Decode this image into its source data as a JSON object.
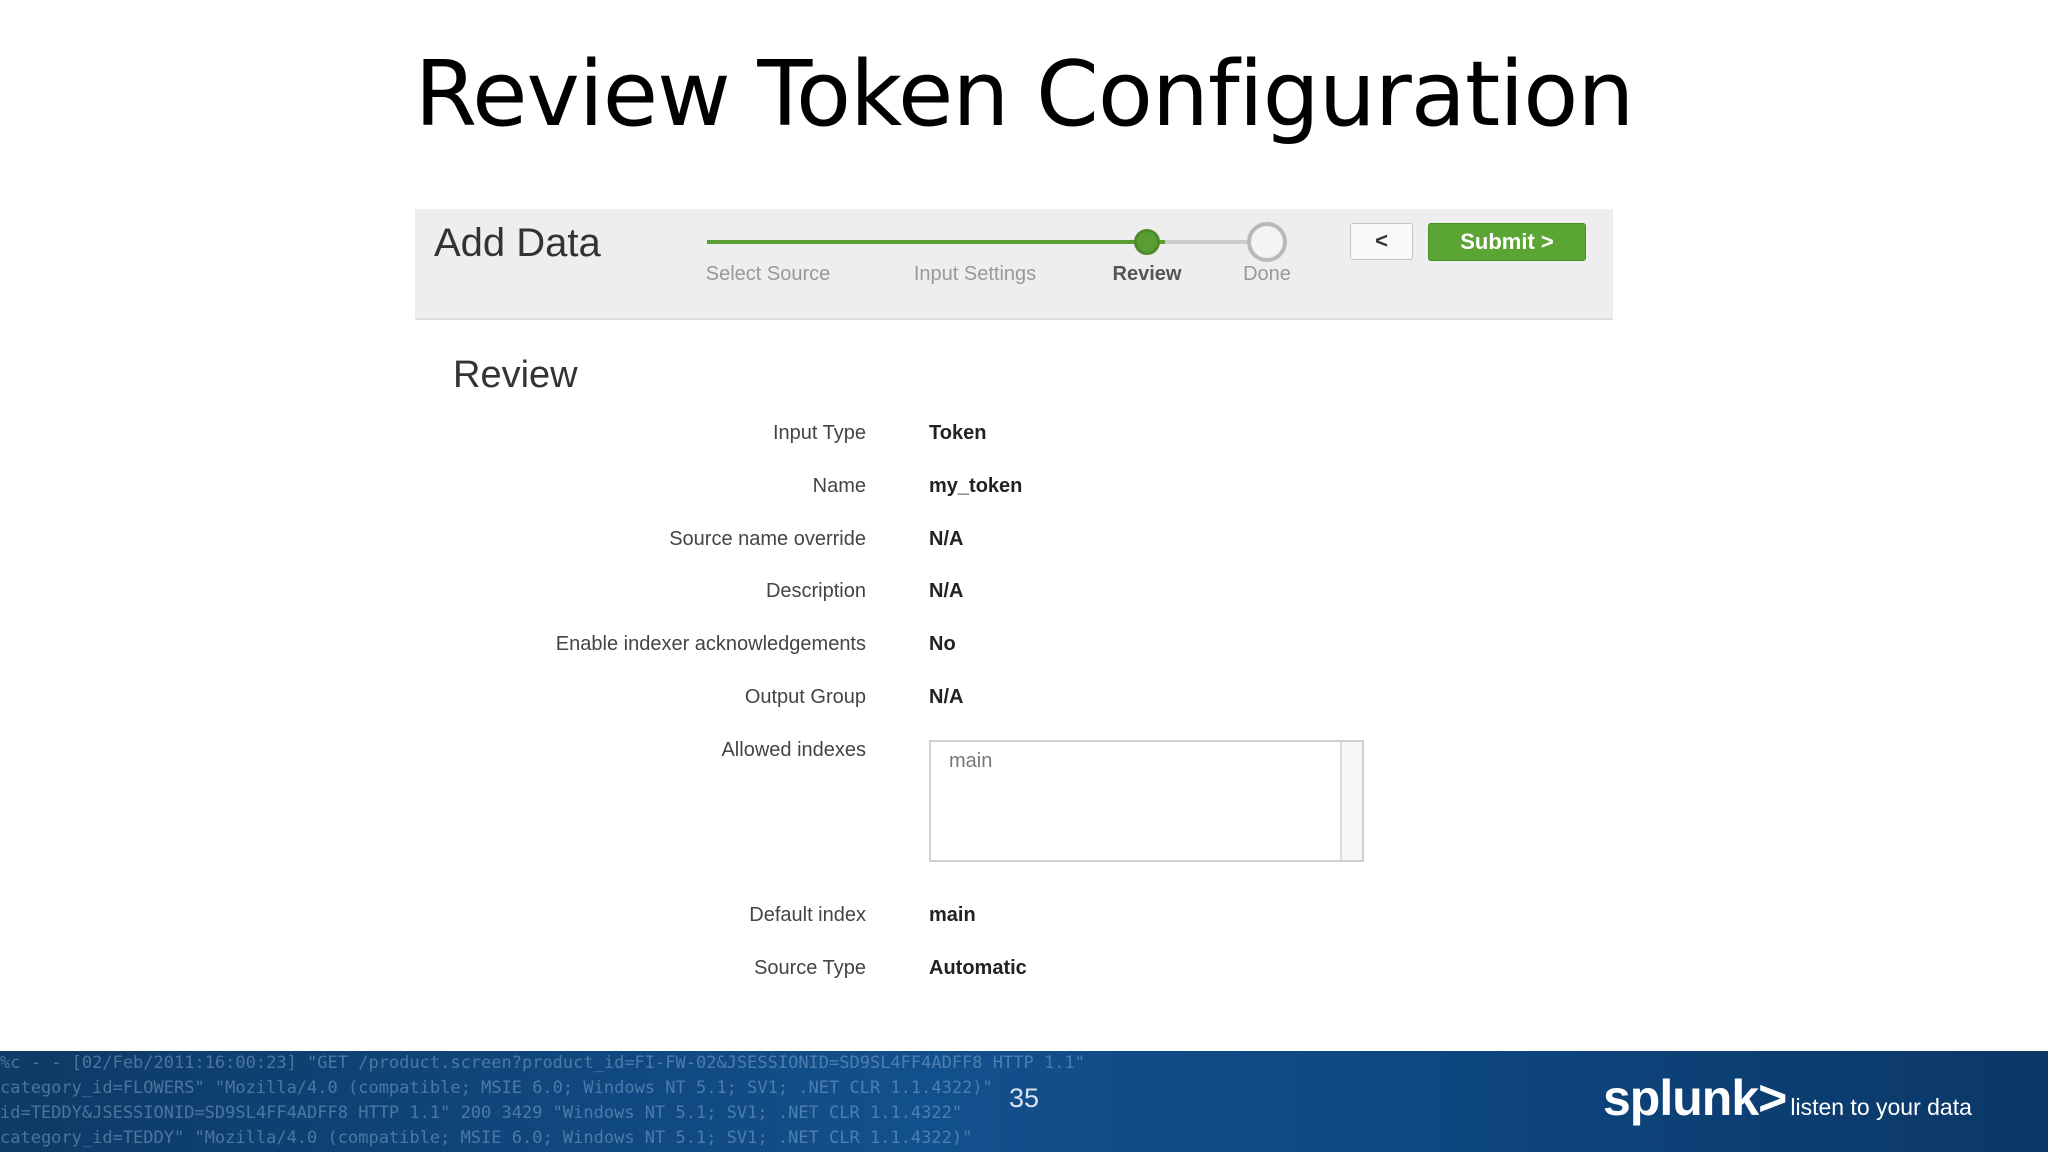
{
  "slide": {
    "title": "Review Token Configuration",
    "page_number": "35"
  },
  "header": {
    "title": "Add Data",
    "steps": [
      {
        "label": "Select Source",
        "state": "done"
      },
      {
        "label": "Input Settings",
        "state": "done"
      },
      {
        "label": "Review",
        "state": "current"
      },
      {
        "label": "Done",
        "state": "todo"
      }
    ],
    "back_label": "<",
    "submit_label": "Submit >"
  },
  "review": {
    "heading": "Review",
    "fields": [
      {
        "label": "Input Type",
        "value": "Token"
      },
      {
        "label": "Name",
        "value": "my_token"
      },
      {
        "label": "Source name override",
        "value": "N/A"
      },
      {
        "label": "Description",
        "value": "N/A"
      },
      {
        "label": "Enable indexer acknowledgements",
        "value": "No"
      },
      {
        "label": "Output Group",
        "value": "N/A"
      }
    ],
    "allowed_indexes": {
      "label": "Allowed indexes",
      "items": [
        "main"
      ]
    },
    "default_index": {
      "label": "Default index",
      "value": "main"
    },
    "source_type": {
      "label": "Source Type",
      "value": "Automatic"
    }
  },
  "footer": {
    "log_lines": [
      "%c - - [02/Feb/2011:16:00:23] \"GET /product.screen?product_id=FI-FW-02&JSESSIONID=SD9SL4FF4ADFF8 HTTP 1.1\"",
      "category_id=FLOWERS\" \"Mozilla/4.0 (compatible; MSIE 6.0; Windows NT 5.1; SV1; .NET CLR 1.1.4322)\"",
      "id=TEDDY&JSESSIONID=SD9SL4FF4ADFF8 HTTP 1.1\" 200 3429 \"Windows NT 5.1; SV1; .NET CLR 1.1.4322\"",
      "category_id=TEDDY\" \"Mozilla/4.0 (compatible; MSIE 6.0; Windows NT 5.1; SV1; .NET CLR 1.1.4322)\""
    ],
    "brand_logo": "splunk>",
    "brand_tagline": "listen to your data"
  },
  "colors": {
    "accent_green": "#5ba534",
    "footer_blue": "#12508d"
  }
}
